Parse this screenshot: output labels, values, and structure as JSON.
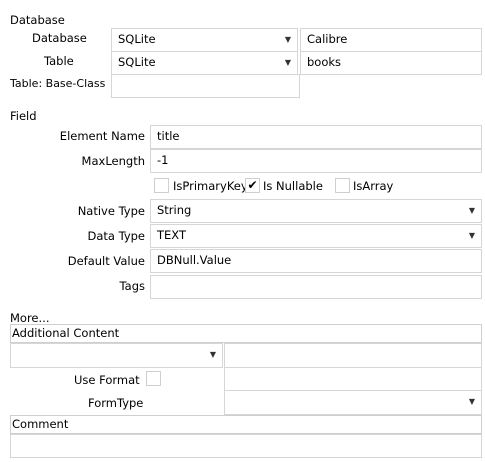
{
  "database_section": {
    "header": "Database",
    "database_label": "Database",
    "database_provider": "SQLite",
    "database_name": "Calibre",
    "table_label": "Table",
    "table_provider": "SQLite",
    "table_name": "books",
    "base_class_label": "Table: Base-Class",
    "base_class_value": ""
  },
  "field_section": {
    "header": "Field",
    "element_name_label": "Element Name",
    "element_name": "title",
    "maxlength_label": "MaxLength",
    "maxlength": "-1",
    "is_primary_key_label": "IsPrimaryKey",
    "is_primary_key": false,
    "is_nullable_label": "Is Nullable",
    "is_nullable": true,
    "is_array_label": "IsArray",
    "is_array": false,
    "native_type_label": "Native Type",
    "native_type": "String",
    "data_type_label": "Data Type",
    "data_type": "TEXT",
    "default_value_label": "Default Value",
    "default_value": "DBNull.Value",
    "tags_label": "Tags",
    "tags": ""
  },
  "more_section": {
    "header": "More...",
    "additional_content_label": "Additional Content",
    "use_format_label": "Use Format",
    "use_format": false,
    "form_type_label": "FormType",
    "comment_label": "Comment",
    "comment": ""
  },
  "icons": {
    "dropdown": "chevron-down-icon",
    "check": "checkmark-icon"
  }
}
